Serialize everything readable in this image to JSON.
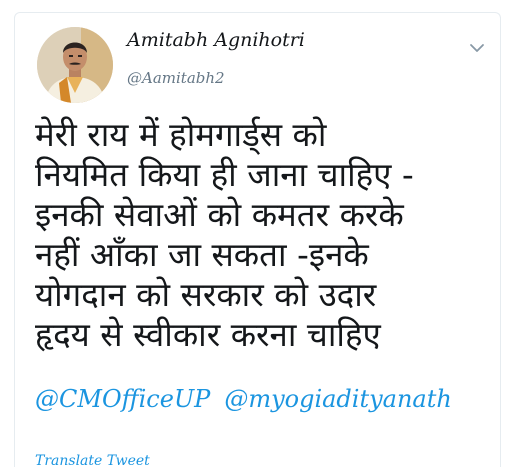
{
  "tweet": {
    "author": {
      "name": "Amitabh Agnihotri",
      "handle": "@Aamitabh2"
    },
    "text_lines": [
      "मेरी राय में होमगार्ड्स को",
      "नियमित किया ही जाना चाहिए -",
      "इनकी सेवाओं को कमतर करके",
      "नहीं आँका जा सकता -इनके",
      "योगदान को सरकार को उदार",
      "हृदय से स्वीकार करना चाहिए"
    ],
    "mentions": [
      "@CMOfficeUP",
      "@myogiadityanath"
    ],
    "translate_label": "Translate Tweet"
  },
  "icons": {
    "menu": "chevron-down-icon",
    "avatar": "avatar-photo"
  },
  "colors": {
    "link": "#1b95e0",
    "text": "#14171a",
    "secondary": "#657786",
    "border": "#e6ecf0"
  }
}
